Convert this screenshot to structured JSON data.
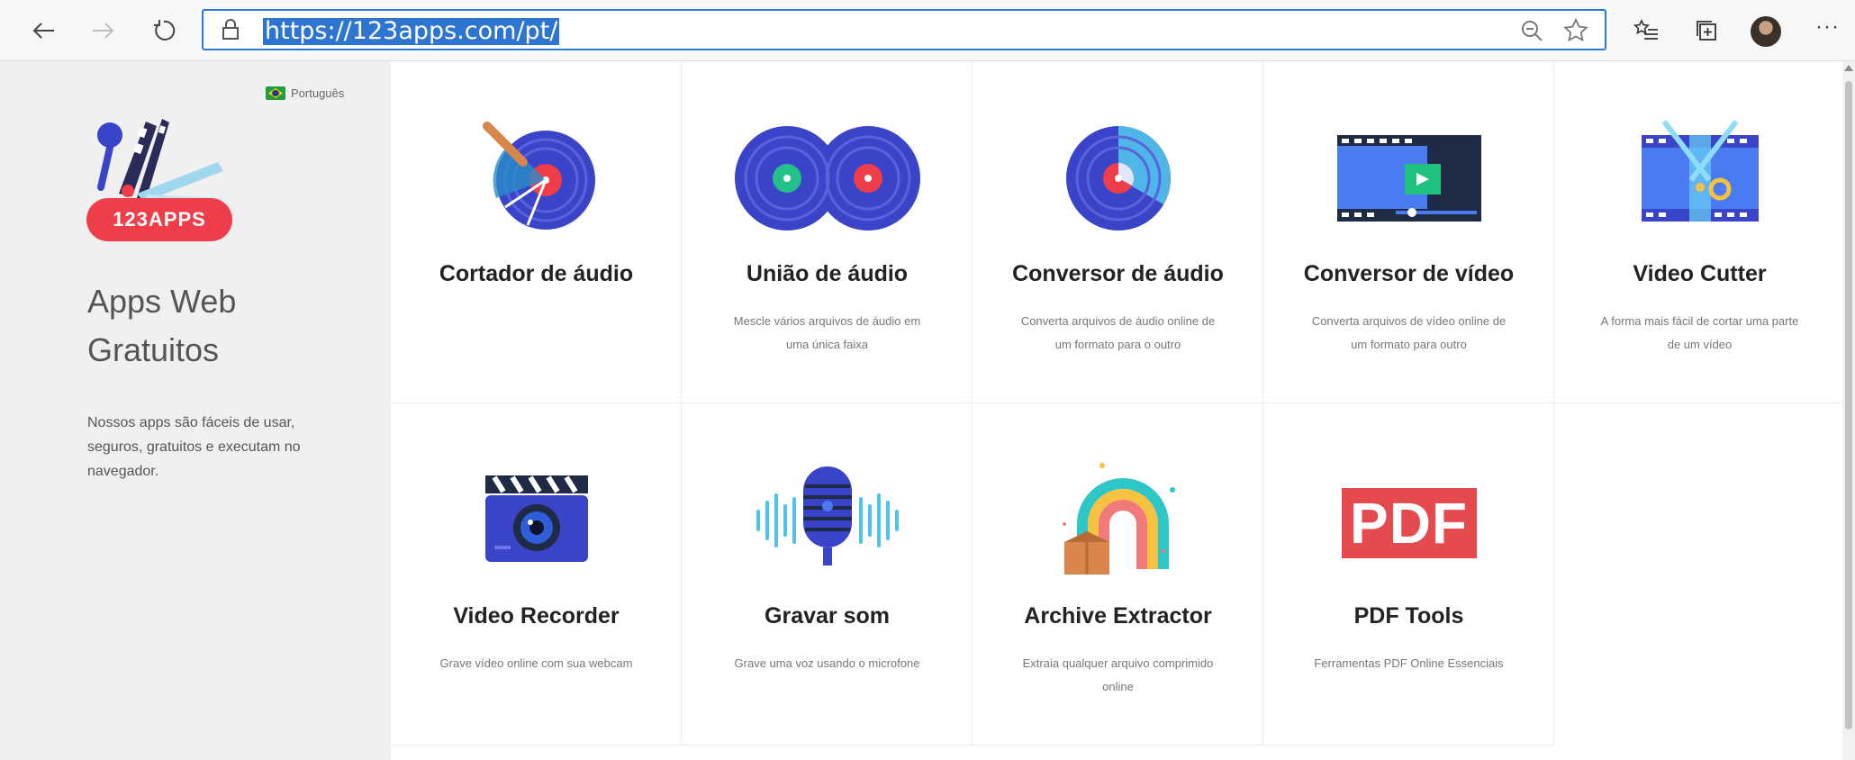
{
  "browser": {
    "url": "https://123apps.com/pt/",
    "more_label": "···"
  },
  "sidebar": {
    "language": "Português",
    "logo_text": "123APPS",
    "title_line1": "Apps Web",
    "title_line2": "Gratuitos",
    "description": "Nossos apps são fáceis de usar, seguros, gratuitos e executam no navegador."
  },
  "apps": [
    {
      "title": "Cortador de áudio",
      "description": "",
      "icon": "audio-cutter-icon"
    },
    {
      "title": "União de áudio",
      "description": "Mescle vários arquivos de áudio em uma única faixa",
      "icon": "audio-joiner-icon"
    },
    {
      "title": "Conversor de áudio",
      "description": "Converta arquivos de áudio online de um formato para o outro",
      "icon": "audio-converter-icon"
    },
    {
      "title": "Conversor de vídeo",
      "description": "Converta arquivos de vídeo online de um formato para outro",
      "icon": "video-converter-icon"
    },
    {
      "title": "Video Cutter",
      "description": "A forma mais fácil de cortar uma parte de um vídeo",
      "icon": "video-cutter-icon"
    },
    {
      "title": "Video Recorder",
      "description": "Grave vídeo online com sua webcam",
      "icon": "video-recorder-icon"
    },
    {
      "title": "Gravar som",
      "description": "Grave uma voz usando o microfone",
      "icon": "voice-recorder-icon"
    },
    {
      "title": "Archive Extractor",
      "description": "Extraia qualquer arquivo comprimido online",
      "icon": "archive-extractor-icon"
    },
    {
      "title": "PDF Tools",
      "description": "Ferramentas PDF Online Essenciais",
      "icon": "pdf-tools-icon",
      "icon_text": "PDF"
    }
  ],
  "colors": {
    "brand_red": "#ef3e4a",
    "vinyl_blue": "#3a44c9",
    "accent_blue": "#2d7ad6",
    "sidebar_bg": "#f1f0f0"
  }
}
